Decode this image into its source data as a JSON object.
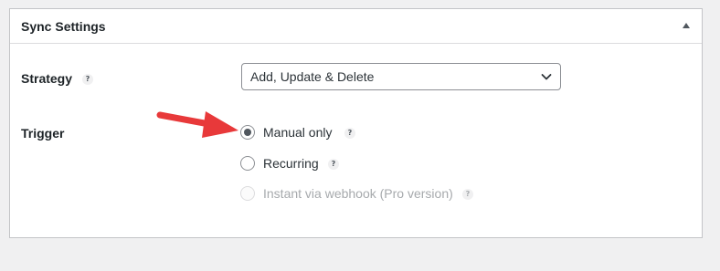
{
  "panel": {
    "title": "Sync Settings"
  },
  "strategy": {
    "label": "Strategy",
    "help": "?",
    "selected": "Add, Update & Delete"
  },
  "trigger": {
    "label": "Trigger",
    "options": [
      {
        "label": "Manual only",
        "checked": true,
        "disabled": false,
        "help": "?"
      },
      {
        "label": "Recurring",
        "checked": false,
        "disabled": false,
        "help": "?"
      },
      {
        "label": "Instant via webhook (Pro version)",
        "checked": false,
        "disabled": true,
        "help": "?"
      }
    ]
  },
  "colors": {
    "annotation_arrow": "#e8393a",
    "panel_border": "#c3c4c7",
    "background": "#f0f0f1"
  },
  "icons": {
    "panel_toggle": "triangle-up-icon",
    "select_toggle": "chevron-down-icon",
    "help": "question-mark-icon",
    "annotation": "red-arrow-icon"
  }
}
